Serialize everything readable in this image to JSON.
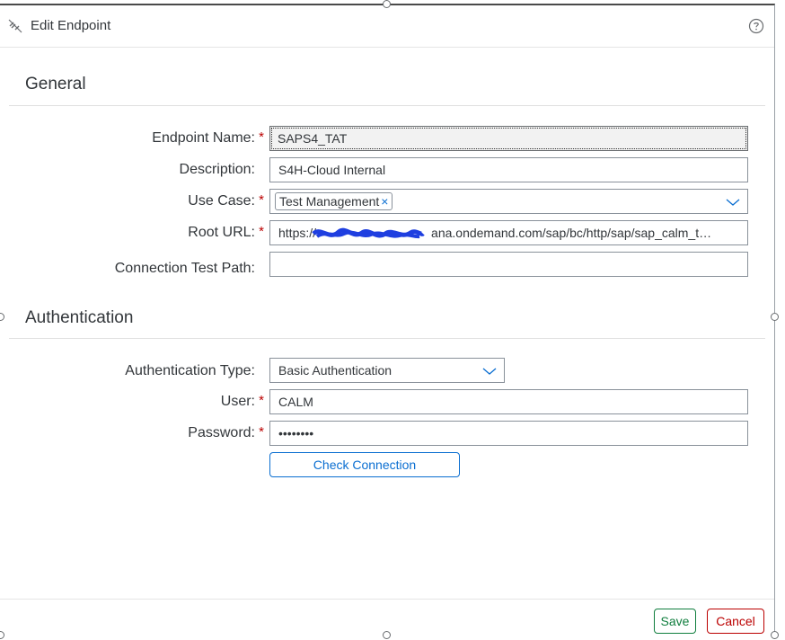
{
  "dialog": {
    "title": "Edit Endpoint",
    "title_icon": "unlink-icon",
    "help_icon": "help-icon"
  },
  "general": {
    "section_title": "General",
    "endpoint_name": {
      "label": "Endpoint Name:",
      "value": "SAPS4_TAT",
      "required": "*"
    },
    "description": {
      "label": "Description:",
      "value": "S4H-Cloud Internal"
    },
    "use_case": {
      "label": "Use Case:",
      "required": "*",
      "token": "Test Management",
      "token_remove": "×"
    },
    "root_url": {
      "label": "Root URL:",
      "required": "*",
      "value_prefix": "https://",
      "value_suffix": "ana.ondemand.com/sap/bc/http/sap/sap_calm_t…"
    },
    "connection_test_path": {
      "label": "Connection Test Path:",
      "value": ""
    }
  },
  "authentication": {
    "section_title": "Authentication",
    "auth_type": {
      "label": "Authentication Type:",
      "value": "Basic Authentication"
    },
    "user": {
      "label": "User:",
      "required": "*",
      "value": "CALM"
    },
    "password": {
      "label": "Password:",
      "required": "*",
      "value": "••••••••"
    },
    "check_connection_label": "Check Connection"
  },
  "footer": {
    "save_label": "Save",
    "cancel_label": "Cancel"
  },
  "colors": {
    "accent": "#0a6ed1",
    "required": "#bb0000",
    "save": "#107e3e",
    "cancel": "#bb0000",
    "redaction": "#1f3fe0"
  }
}
